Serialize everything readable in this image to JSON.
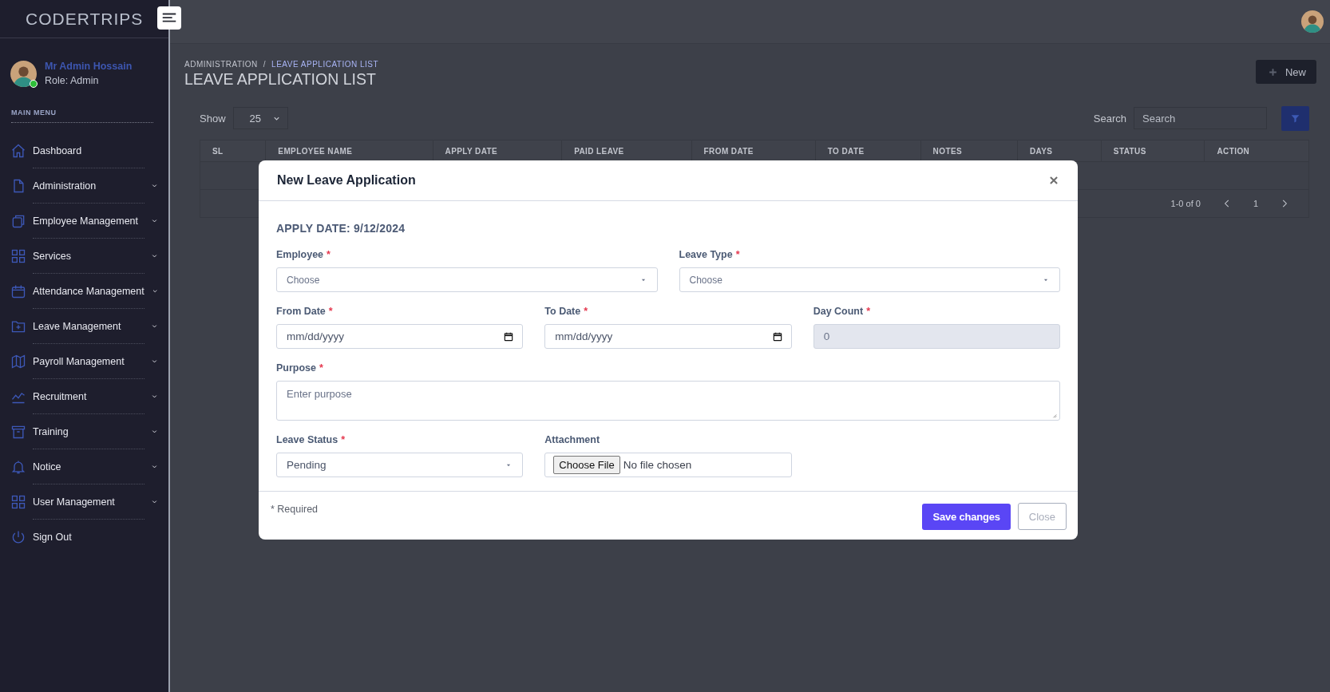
{
  "brand": "CODERTRIPS",
  "user": {
    "name": "Mr Admin Hossain",
    "role": "Role: Admin",
    "online": true
  },
  "sidebar": {
    "section": "MAIN MENU",
    "items": [
      {
        "label": "Dashboard",
        "expandable": false
      },
      {
        "label": "Administration",
        "expandable": true
      },
      {
        "label": "Employee Management",
        "expandable": true
      },
      {
        "label": "Services",
        "expandable": true
      },
      {
        "label": "Attendance Management",
        "expandable": true
      },
      {
        "label": "Leave Management",
        "expandable": true
      },
      {
        "label": "Payroll Management",
        "expandable": true
      },
      {
        "label": "Recruitment",
        "expandable": true
      },
      {
        "label": "Training",
        "expandable": true
      },
      {
        "label": "Notice",
        "expandable": true
      },
      {
        "label": "User Management",
        "expandable": true
      },
      {
        "label": "Sign Out",
        "expandable": false
      }
    ]
  },
  "page": {
    "breadcrumb": [
      {
        "label": "ADMINISTRATION",
        "current": false
      },
      {
        "label": "LEAVE APPLICATION LIST",
        "current": true
      }
    ],
    "separator": "/",
    "title": "LEAVE APPLICATION LIST",
    "new_button": "New"
  },
  "toolbar": {
    "show_label": "Show",
    "page_size": "25",
    "search_label": "Search",
    "search_placeholder": "Search"
  },
  "table": {
    "columns": [
      "SL",
      "EMPLOYEE NAME",
      "APPLY DATE",
      "PAID LEAVE",
      "FROM DATE",
      "TO DATE",
      "NOTES",
      "DAYS",
      "STATUS",
      "ACTION"
    ],
    "pagination": {
      "range": "1-0 of 0",
      "page": "1"
    }
  },
  "modal": {
    "title": "New Leave Application",
    "apply_date": "APPLY DATE: 9/12/2024",
    "required_mark": "*",
    "rows": [
      [
        {
          "label": "Employee",
          "required": true,
          "kind": "select",
          "placeholder": "Choose"
        },
        {
          "label": "Leave Type",
          "required": true,
          "kind": "select",
          "placeholder": "Choose"
        }
      ],
      [
        {
          "label": "From Date",
          "required": true,
          "kind": "date",
          "placeholder": "mm/dd/yyyy"
        },
        {
          "label": "To Date",
          "required": true,
          "kind": "date",
          "placeholder": "mm/dd/yyyy"
        },
        {
          "label": "Day Count",
          "required": true,
          "kind": "number",
          "value": "0",
          "disabled": true
        }
      ],
      [
        {
          "label": "Purpose",
          "required": true,
          "kind": "textarea",
          "placeholder": "Enter purpose"
        }
      ],
      [
        {
          "label": "Leave Status",
          "required": true,
          "kind": "select",
          "value": "Pending"
        },
        {
          "label": "Attachment",
          "required": false,
          "kind": "file",
          "button": "Choose File",
          "status": "No file chosen"
        }
      ]
    ],
    "required_note": "* Required",
    "buttons": [
      {
        "label": "Save changes",
        "kind": "primary"
      },
      {
        "label": "Close",
        "kind": "secondary"
      }
    ]
  }
}
